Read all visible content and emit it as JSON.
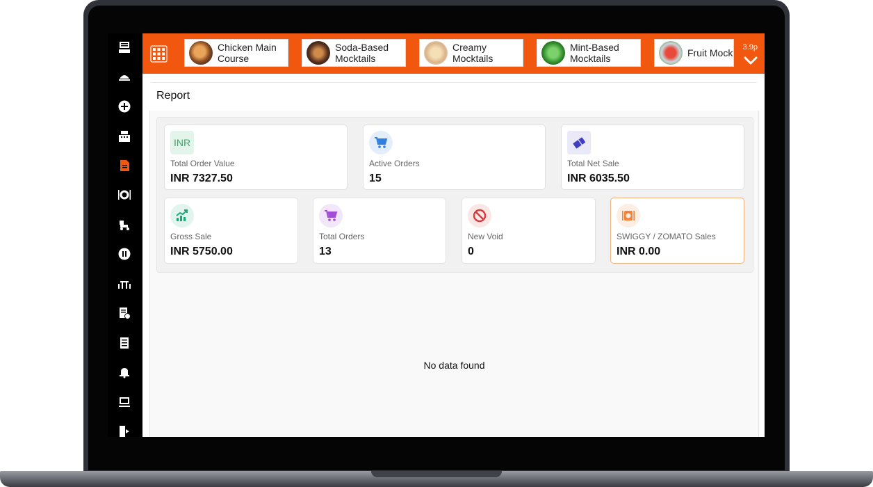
{
  "app": {
    "sidebar": {
      "icons": [
        "pos-terminal-icon",
        "dine-in-icon",
        "add-icon",
        "cash-register-icon",
        "report-icon",
        "plate-icon",
        "delivery-icon",
        "pause-icon",
        "table-icon",
        "bill-icon",
        "receipt-icon",
        "bell-icon",
        "computer-icon",
        "logout-icon"
      ],
      "active_color": "#f2570f"
    },
    "topbar": {
      "categories": [
        {
          "label": "Chicken Main Course"
        },
        {
          "label": "Soda-Based Mocktails"
        },
        {
          "label": "Creamy Mocktails"
        },
        {
          "label": "Mint-Based Mocktails"
        },
        {
          "label": "Fruit Mockt"
        }
      ],
      "version": "3.9p",
      "accent": "#f2570f"
    },
    "report": {
      "title": "Report",
      "cards": [
        {
          "label": "Total Order Value",
          "value": "INR  7327.50",
          "icon": "INR"
        },
        {
          "label": "Active Orders",
          "value": "15",
          "icon": "cart-icon"
        },
        {
          "label": "Total Net Sale",
          "value": "INR  6035.50",
          "icon": "ticket-icon"
        },
        {
          "label": "Gross Sale",
          "value": "INR  5750.00",
          "icon": "growth-chart-icon"
        },
        {
          "label": "Total Orders",
          "value": "13",
          "icon": "cart-icon"
        },
        {
          "label": "New Void",
          "value": "0",
          "icon": "no-entry-icon"
        },
        {
          "label": "SWIGGY / ZOMATO Sales",
          "value": "INR  0.00",
          "icon": "food-plate-icon"
        }
      ],
      "empty_message": "No data found"
    }
  }
}
